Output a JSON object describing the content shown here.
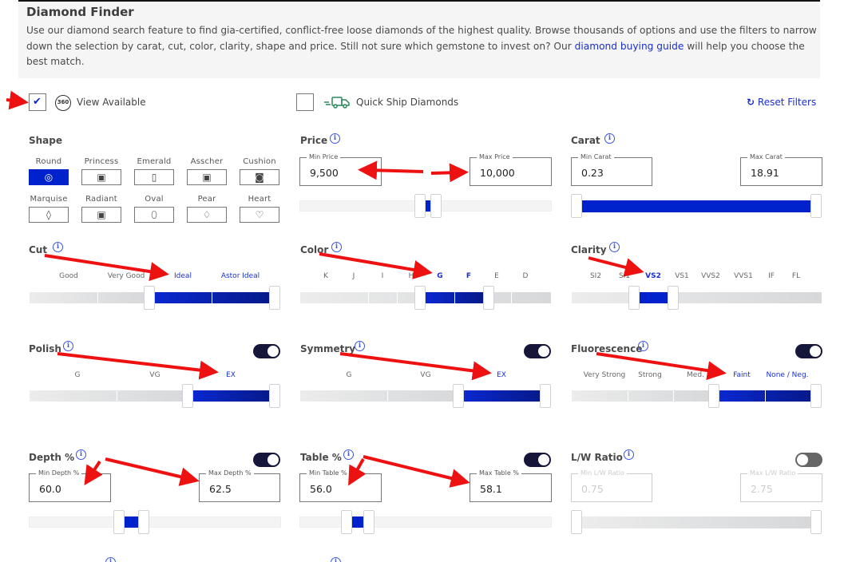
{
  "intro": {
    "title": "Diamond Finder",
    "desc_before": "Use our diamond search feature to find gia-certified, conflict-free loose diamonds of the highest quality. Browse thousands of options and use the filters to narrow down the selection by carat, cut, color, clarity, shape and price. Still not sure which gemstone to invest on? Our ",
    "link": "diamond buying guide",
    "desc_after": " will help you choose the best match."
  },
  "options": {
    "view_available": {
      "label": "View Available",
      "badge": "360",
      "checked": true
    },
    "quick_ship": {
      "label": "Quick Ship Diamonds",
      "checked": false
    },
    "reset": {
      "label": "Reset Filters",
      "icon": "refresh-icon"
    }
  },
  "shape": {
    "title": "Shape",
    "selected": "Round",
    "items": [
      "Round",
      "Princess",
      "Emerald",
      "Asscher",
      "Cushion",
      "Marquise",
      "Radiant",
      "Oval",
      "Pear",
      "Heart"
    ]
  },
  "price": {
    "title": "Price",
    "min_label": "Min Price",
    "max_label": "Max Price",
    "min": "9,500",
    "max": "10,000",
    "range_fraction": [
      0.5,
      0.53
    ]
  },
  "carat": {
    "title": "Carat",
    "min_label": "Min Carat",
    "max_label": "Max Carat",
    "min": "0.23",
    "max": "18.91",
    "range_fraction": [
      0,
      1
    ]
  },
  "cut": {
    "title": "Cut",
    "grades": [
      "Good",
      "Very Good",
      "Ideal",
      "Astor Ideal"
    ],
    "selected": [
      "Ideal",
      "Astor Ideal"
    ]
  },
  "color": {
    "title": "Color",
    "grades": [
      "K",
      "J",
      "I",
      "H",
      "G",
      "F",
      "E",
      "D"
    ],
    "selected": [
      "G",
      "F"
    ]
  },
  "clarity": {
    "title": "Clarity",
    "grades": [
      "SI2",
      "SI1",
      "VS2",
      "VS1",
      "VVS2",
      "VVS1",
      "IF",
      "FL"
    ],
    "selected": [
      "VS2"
    ]
  },
  "polish": {
    "title": "Polish",
    "toggle_on": true,
    "grades": [
      "G",
      "VG",
      "EX"
    ],
    "selected": [
      "EX"
    ]
  },
  "symmetry": {
    "title": "Symmetry",
    "toggle_on": true,
    "grades": [
      "G",
      "VG",
      "EX"
    ],
    "selected": [
      "EX"
    ]
  },
  "fluorescence": {
    "title": "Fluorescence",
    "toggle_on": true,
    "grades": [
      "Very Strong",
      "Strong",
      "Med.",
      "Faint",
      "None / Neg."
    ],
    "selected": [
      "Faint",
      "None / Neg."
    ]
  },
  "depth": {
    "title": "Depth %",
    "toggle_on": true,
    "min_label": "Min Depth %",
    "max_label": "Max Depth %",
    "min": "60.0",
    "max": "62.5"
  },
  "table": {
    "title": "Table %",
    "toggle_on": true,
    "min_label": "Min Table %",
    "max_label": "Max Table %",
    "min": "56.0",
    "max": "58.1"
  },
  "lw_ratio": {
    "title": "L/W Ratio",
    "toggle_on": false,
    "min_label": "Min L/W Ratio",
    "max_label": "Max L/W Ratio",
    "min": "0.75",
    "max": "2.75"
  },
  "annotation_color": "#ee1111"
}
